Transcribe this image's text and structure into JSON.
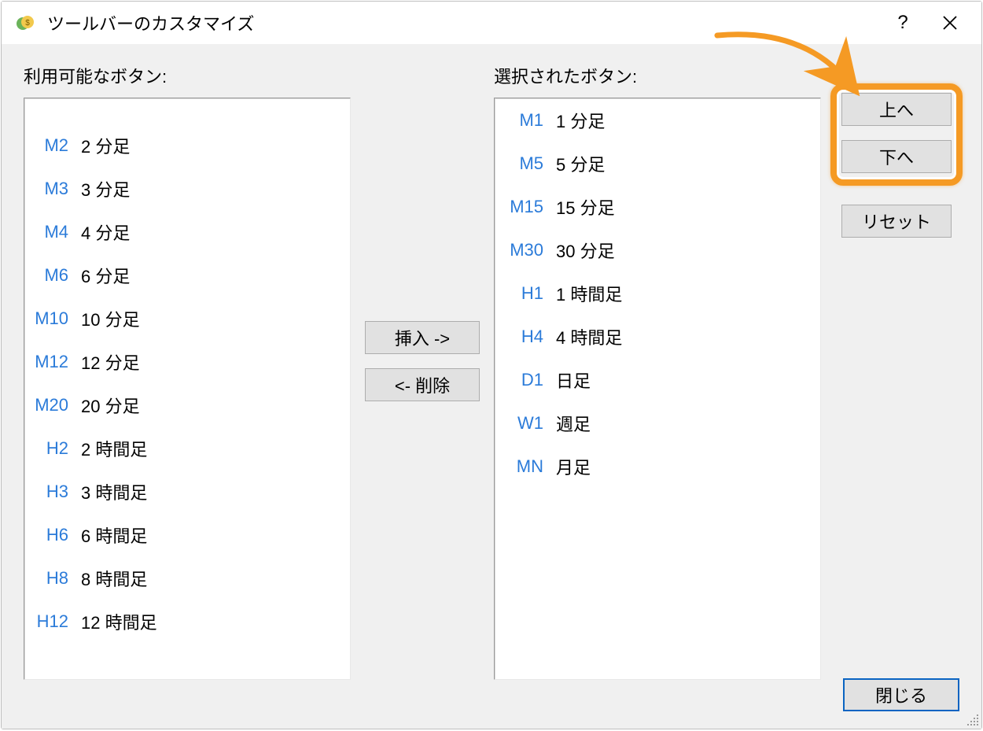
{
  "window": {
    "title": "ツールバーのカスタマイズ",
    "help_icon": "?",
    "close_icon": "×"
  },
  "labels": {
    "available": "利用可能なボタン:",
    "selected": "選択されたボタン:"
  },
  "buttons": {
    "insert": "挿入 ->",
    "remove": "<- 削除",
    "up": "上へ",
    "down": "下へ",
    "reset": "リセット",
    "close": "閉じる"
  },
  "available_items": [
    {
      "code": "",
      "desc": ""
    },
    {
      "code": "M2",
      "desc": "2 分足"
    },
    {
      "code": "M3",
      "desc": "3 分足"
    },
    {
      "code": "M4",
      "desc": "4 分足"
    },
    {
      "code": "M6",
      "desc": "6 分足"
    },
    {
      "code": "M10",
      "desc": "10 分足"
    },
    {
      "code": "M12",
      "desc": "12 分足"
    },
    {
      "code": "M20",
      "desc": "20 分足"
    },
    {
      "code": "H2",
      "desc": "2 時間足"
    },
    {
      "code": "H3",
      "desc": "3 時間足"
    },
    {
      "code": "H6",
      "desc": "6 時間足"
    },
    {
      "code": "H8",
      "desc": "8 時間足"
    },
    {
      "code": "H12",
      "desc": "12 時間足"
    }
  ],
  "selected_items": [
    {
      "code": "M1",
      "desc": "1 分足"
    },
    {
      "code": "M5",
      "desc": "5 分足"
    },
    {
      "code": "M15",
      "desc": "15 分足"
    },
    {
      "code": "M30",
      "desc": "30 分足"
    },
    {
      "code": "H1",
      "desc": "1 時間足"
    },
    {
      "code": "H4",
      "desc": "4 時間足"
    },
    {
      "code": "D1",
      "desc": "日足"
    },
    {
      "code": "W1",
      "desc": "週足"
    },
    {
      "code": "MN",
      "desc": "月足"
    }
  ]
}
